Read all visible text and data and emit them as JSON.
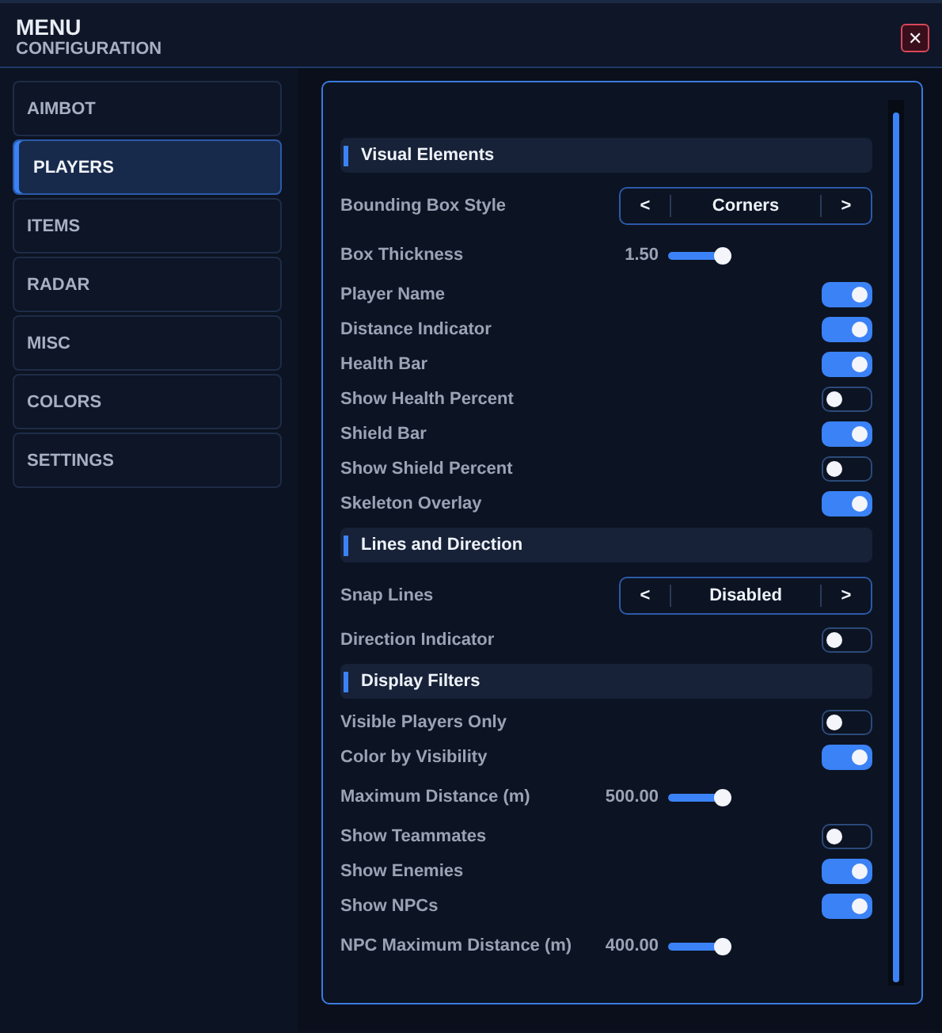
{
  "window": {
    "title": "MENU",
    "subtitle": "CONFIGURATION",
    "close": "✕"
  },
  "sidebar": {
    "items": [
      {
        "label": "AIMBOT",
        "selected": false
      },
      {
        "label": "PLAYERS",
        "selected": true
      },
      {
        "label": "ITEMS",
        "selected": false
      },
      {
        "label": "RADAR",
        "selected": false
      },
      {
        "label": "MISC",
        "selected": false
      },
      {
        "label": "COLORS",
        "selected": false
      },
      {
        "label": "SETTINGS",
        "selected": false
      }
    ]
  },
  "settings": [
    {
      "kind": "section",
      "label": "Visual Elements"
    },
    {
      "kind": "selector",
      "label": "Bounding Box Style",
      "prev": "<",
      "value": "Corners",
      "next": ">"
    },
    {
      "kind": "slider",
      "label": "Box Thickness",
      "reading": "1.50"
    },
    {
      "kind": "toggle",
      "label": "Player Name",
      "on": true
    },
    {
      "kind": "toggle",
      "label": "Distance Indicator",
      "on": true
    },
    {
      "kind": "toggle",
      "label": "Health Bar",
      "on": true
    },
    {
      "kind": "toggle",
      "label": "Show Health Percent",
      "on": false
    },
    {
      "kind": "toggle",
      "label": "Shield Bar",
      "on": true
    },
    {
      "kind": "toggle",
      "label": "Show Shield Percent",
      "on": false
    },
    {
      "kind": "toggle",
      "label": "Skeleton Overlay",
      "on": true
    },
    {
      "kind": "section",
      "label": "Lines and Direction"
    },
    {
      "kind": "selector",
      "label": "Snap Lines",
      "prev": "<",
      "value": "Disabled",
      "next": ">"
    },
    {
      "kind": "toggle",
      "label": "Direction Indicator",
      "on": false
    },
    {
      "kind": "section",
      "label": "Display Filters"
    },
    {
      "kind": "toggle",
      "label": "Visible Players Only",
      "on": false
    },
    {
      "kind": "toggle",
      "label": "Color by Visibility",
      "on": true
    },
    {
      "kind": "slider",
      "label": "Maximum Distance (m)",
      "reading": "500.00"
    },
    {
      "kind": "toggle",
      "label": "Show Teammates",
      "on": false
    },
    {
      "kind": "toggle",
      "label": "Show Enemies",
      "on": true
    },
    {
      "kind": "toggle",
      "label": "Show NPCs",
      "on": true
    },
    {
      "kind": "slider",
      "label": "NPC Maximum Distance (m)",
      "reading": "400.00"
    }
  ]
}
